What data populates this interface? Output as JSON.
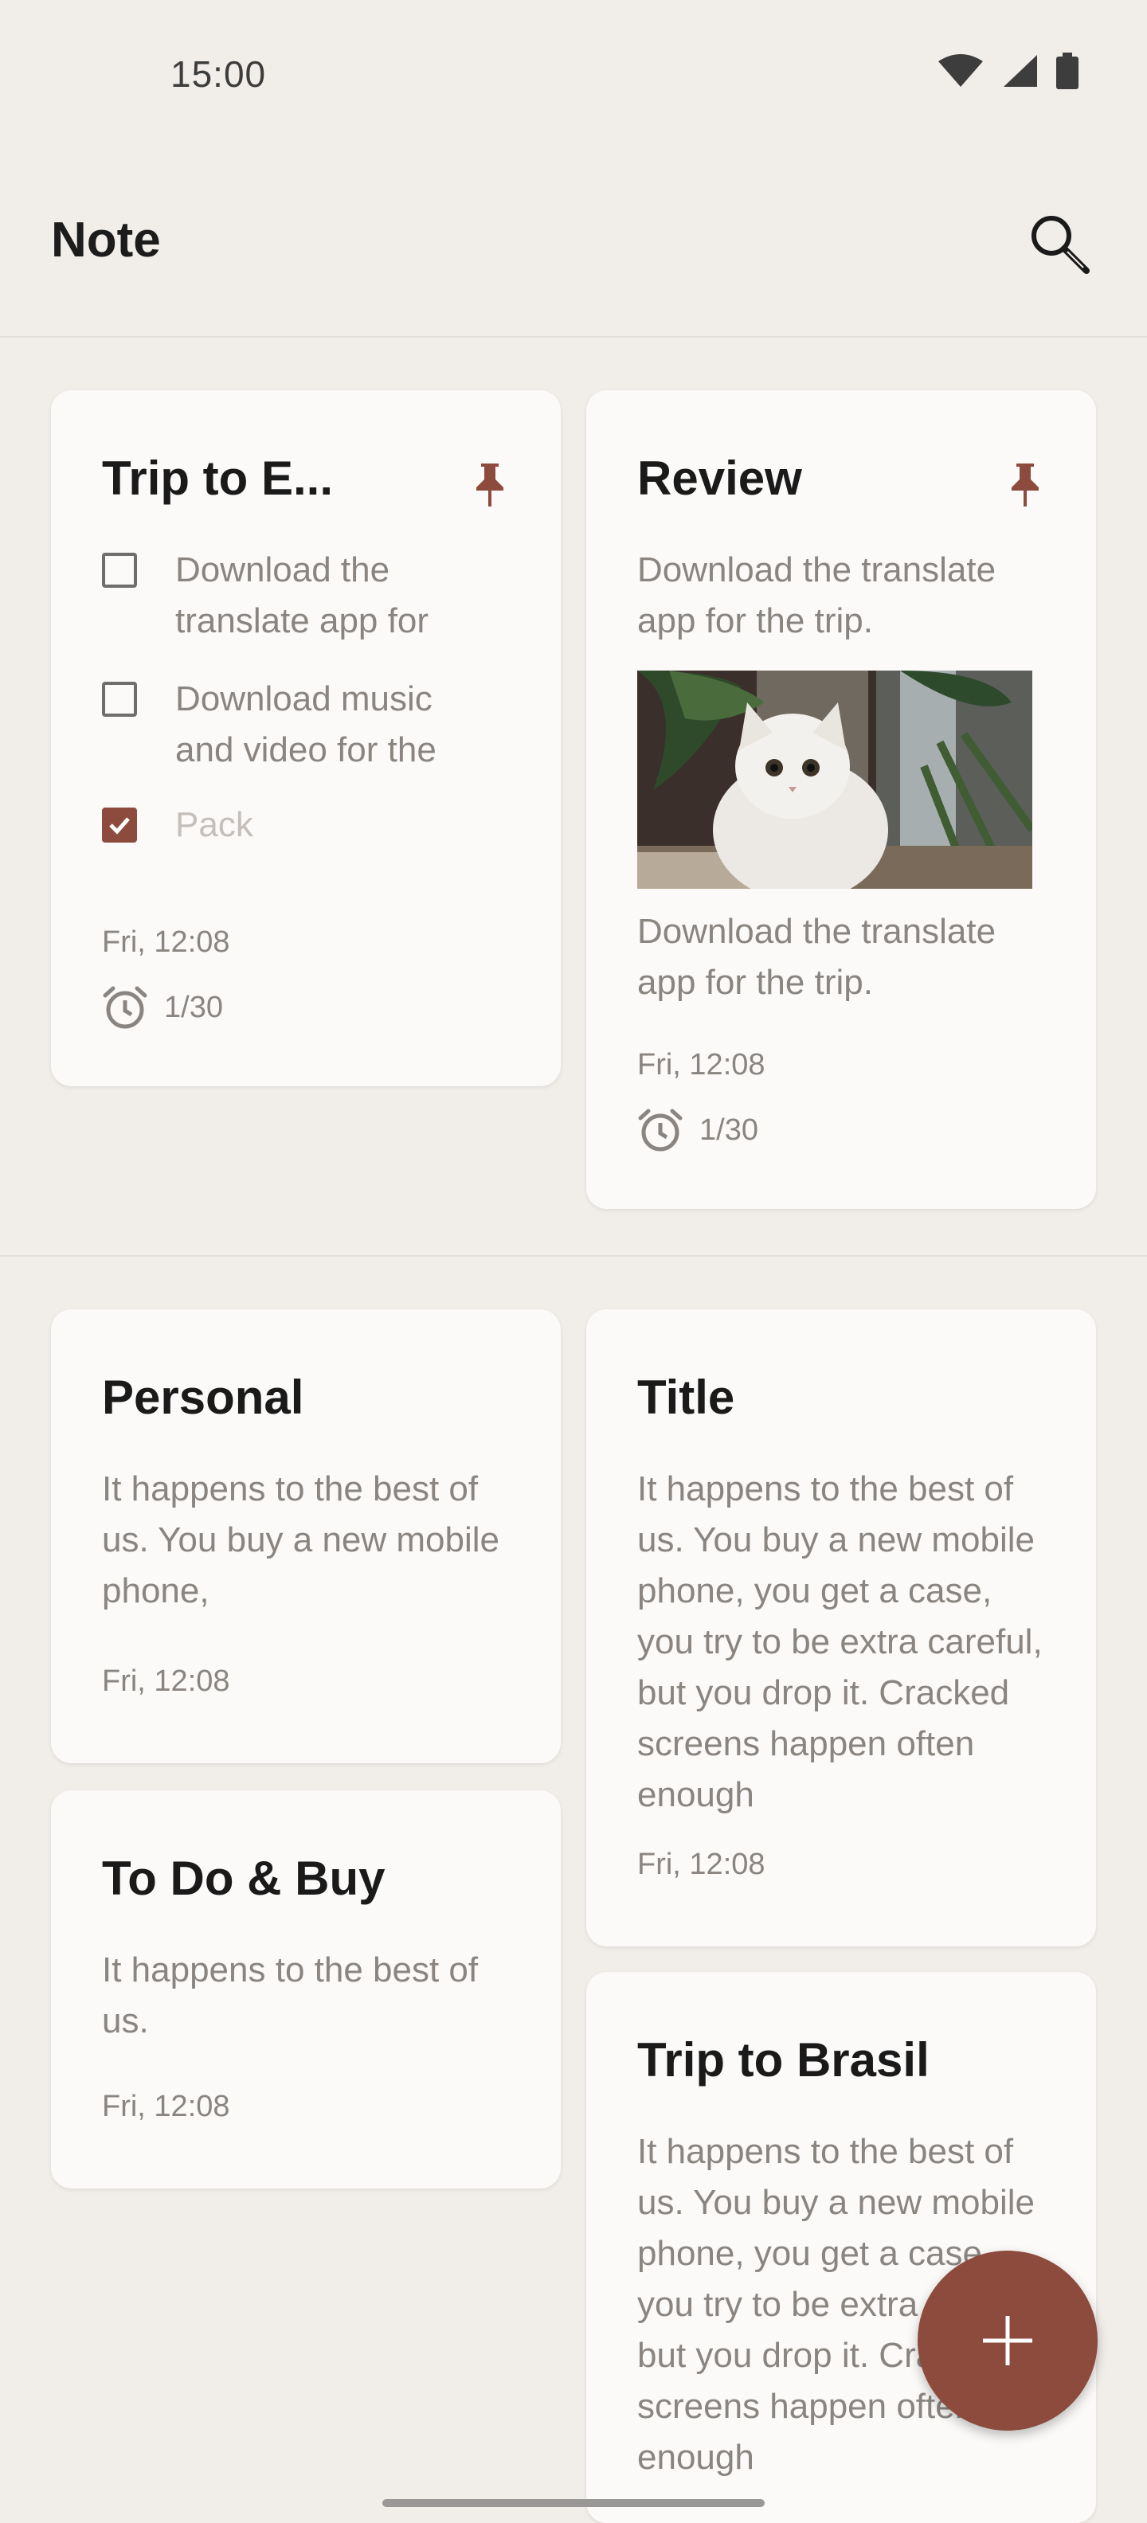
{
  "status_bar": {
    "time": "15:00",
    "icons": [
      "wifi-icon",
      "signal-icon",
      "battery-icon"
    ]
  },
  "app_bar": {
    "title": "Note",
    "search_icon": "search-icon"
  },
  "colors": {
    "accent": "#8c4b3c",
    "background": "#f1eeea",
    "card": "#fbfaf9",
    "muted_text": "#8a8580"
  },
  "pinned": [
    {
      "title": "Trip to E...",
      "checklist": [
        {
          "text": "Download the translate app for",
          "checked": false
        },
        {
          "text": "Download music and video for the",
          "checked": false
        },
        {
          "text": "Pack",
          "checked": true
        }
      ],
      "date": "Fri, 12:08",
      "reminder": "1/30"
    },
    {
      "title": "Review",
      "text_before": "Download the translate app for the trip.",
      "image": "cat-photo",
      "text_after": "Download the translate app for the trip.",
      "date": "Fri, 12:08",
      "reminder": "1/30"
    }
  ],
  "notes": [
    {
      "title": "Personal",
      "text": "It happens to the best of us. You buy a new mobile phone,",
      "date": "Fri, 12:08"
    },
    {
      "title": "Title",
      "text": "It happens to the best of us. You buy a new mobile phone, you get a case, you try to be extra careful, but you drop it. Cracked screens happen often enough",
      "date": "Fri, 12:08"
    },
    {
      "title": "To Do & Buy",
      "text": "It happens to the best of us.",
      "date": "Fri, 12:08"
    },
    {
      "title": "Trip to Brasil",
      "text": "It happens to the best of us. You buy a new mobile phone, you get a case, you try to be extra careful, but you drop it. Cracked screens happen often enough"
    }
  ],
  "fab": {
    "icon": "plus-icon"
  }
}
